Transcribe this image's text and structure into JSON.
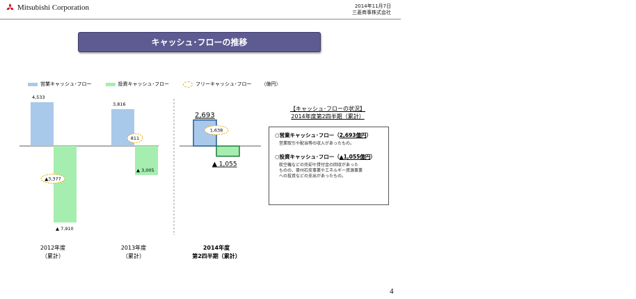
{
  "header": {
    "company": "Mitsubishi Corporation",
    "date": "2014年11月7日",
    "company_jp": "三菱商事株式会社",
    "logo_icon": "three-diamonds-logo-icon",
    "logo_color": "#d0021b"
  },
  "title": "キャッシュ･フローの推移",
  "legend": {
    "operating": "営業キャッシュ･フロー",
    "investing": "投資キャッシュ･フロー",
    "free": "フリーキャッシュ･フロー",
    "unit": "（億円）"
  },
  "chart_data": {
    "type": "bar",
    "unit": "（億円）",
    "categories": [
      {
        "line1": "2012年度",
        "line2": "（累計）",
        "bold": false
      },
      {
        "line1": "2013年度",
        "line2": "（累計）",
        "bold": false
      },
      {
        "line1": "2014年度",
        "line2": "第2四半期（累計）",
        "bold": true
      }
    ],
    "series": [
      {
        "name": "営業キャッシュ･フロー",
        "values": [
          4533,
          3816,
          2693
        ],
        "labels": [
          "4,533",
          "3,816",
          "2,693"
        ],
        "color": "#a9c9ea"
      },
      {
        "name": "投資キャッシュ･フロー",
        "values": [
          -7910,
          -3005,
          -1055
        ],
        "labels": [
          "▲ 7,910",
          "▲ 3,005",
          "▲ 1,055"
        ],
        "color": "#a6eeb0"
      },
      {
        "name": "フリーキャッシュ･フロー",
        "values": [
          -3377,
          811,
          1638
        ],
        "labels": [
          "▲3,377",
          "811",
          "1,638"
        ],
        "color": "#e7a800"
      }
    ],
    "highlight_border": [
      "#205a93",
      "#1e7a3a"
    ]
  },
  "info": {
    "title_line1": "【キャッシュ･フローの状況】",
    "title_line2": "2014年度第2四半期（累計）",
    "sections": [
      {
        "head_prefix": "○営業キャッシュ･フロー（",
        "head_value": "2,693億円",
        "head_suffix": "）",
        "body": "営業取引や配当等の収入があったもの。"
      },
      {
        "head_prefix": "○投資キャッシュ･フロー（",
        "head_value": "▲1,055億円",
        "head_suffix": "）",
        "body": "航空機などの売却や貸付金の回収があった\nものの、豪州石炭事業やエネルギー資源事業\nへの投資などの支出があったもの。"
      }
    ]
  },
  "page_number": "4"
}
